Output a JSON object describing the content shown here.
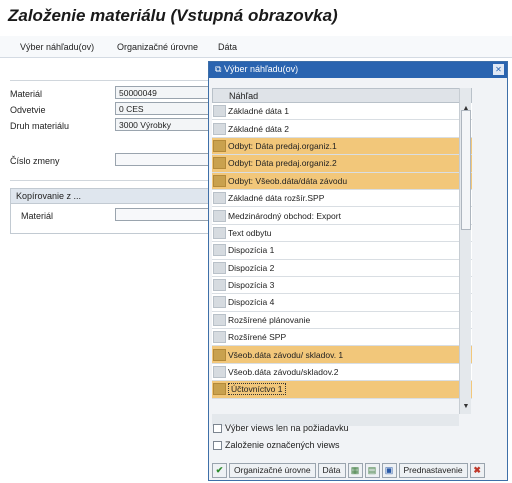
{
  "page": {
    "title": "Založenie materiálu (Vstupná obrazovka)"
  },
  "menu": {
    "items": [
      "Výber náhľadu(ov)",
      "Organizačné úrovne",
      "Dáta"
    ]
  },
  "form": {
    "material_label": "Materiál",
    "material_value": "50000049",
    "odvetvie_label": "Odvetvie",
    "odvetvie_value": "0 CES",
    "druh_label": "Druh materiálu",
    "druh_value": "3000 Výrobky",
    "zmena_label": "Číslo zmeny",
    "zmena_value": "",
    "copy_group_title": "Kopírovanie z ...",
    "copy_material_label": "Materiál",
    "copy_material_value": ""
  },
  "dialog": {
    "title": "Výber náhľadu(ov)",
    "column_header": "Náhľad",
    "rows": [
      {
        "label": "Základné dáta 1",
        "selected": false
      },
      {
        "label": "Základné dáta 2",
        "selected": false
      },
      {
        "label": "Odbyt: Dáta predaj.organiz.1",
        "selected": true
      },
      {
        "label": "Odbyt: Dáta predaj.organiz.2",
        "selected": true
      },
      {
        "label": "Odbyt: Všeob.dáta/dáta závodu",
        "selected": true
      },
      {
        "label": "Základné dáta rozšír.SPP",
        "selected": false
      },
      {
        "label": "Medzinárodný obchod: Export",
        "selected": false
      },
      {
        "label": "Text odbytu",
        "selected": false
      },
      {
        "label": "Dispozícia 1",
        "selected": false
      },
      {
        "label": "Dispozícia 2",
        "selected": false
      },
      {
        "label": "Dispozícia 3",
        "selected": false
      },
      {
        "label": "Dispozícia 4",
        "selected": false
      },
      {
        "label": "Rozšírené plánovanie",
        "selected": false
      },
      {
        "label": "Rozšírené SPP",
        "selected": false
      },
      {
        "label": "Všeob.dáta závodu/ skladov. 1",
        "selected": true
      },
      {
        "label": "Všeob.dáta závodu/skladov.2",
        "selected": false
      },
      {
        "label": "Účtovníctvo 1",
        "selected": true
      }
    ],
    "checkbox1": "Výber views len na požiadavku",
    "checkbox2": "Založenie označených views",
    "btn_org": "Organizačné úrovne",
    "btn_data": "Dáta",
    "btn_default": "Prednastavenie"
  },
  "colors": {
    "selected_row": "#f2c77a",
    "title_bar": "#2a64b0"
  }
}
